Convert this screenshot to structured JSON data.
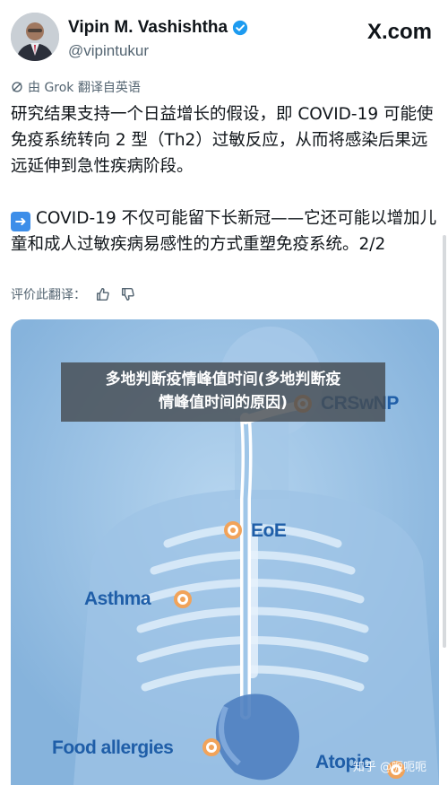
{
  "tweet": {
    "author_name": "Vipin M. Vashishtha",
    "handle": "@vipintukur",
    "platform_logo": "X.com",
    "translation_note": "由 Grok 翻译自英语",
    "paragraphs": [
      "研究结果支持一个日益增长的假设，即 COVID-19 可能使免疫系统转向 2 型（Th2）过敏反应，从而将感染后果远远延伸到急性疾病阶段。",
      "COVID-19 不仅可能留下长新冠——它还可能以增加儿童和成人过敏疾病易感性的方式重塑免疫系统。2/2"
    ],
    "rate_prompt": "评价此翻译：",
    "icons": {
      "verified": "verified-badge-icon",
      "grok": "grok-icon",
      "arrow": "right-arrow-icon",
      "thumbs_up": "thumbs-up-icon",
      "thumbs_down": "thumbs-down-icon"
    }
  },
  "media": {
    "labels": {
      "crswnp": "CRSwNP",
      "eoe": "EoE",
      "asthma": "Asthma",
      "food": "Food allergies",
      "atopic": "Atopic"
    },
    "colors": {
      "background": "#8fbbe0",
      "marker": "#f1a35a",
      "label": "#1f5ea8"
    }
  },
  "overlay_title": {
    "line1": "多地判断疫情峰值时间(多地判断疫",
    "line2": "情峰值时间的原因)"
  },
  "watermark": "知乎 @呃呃呃"
}
